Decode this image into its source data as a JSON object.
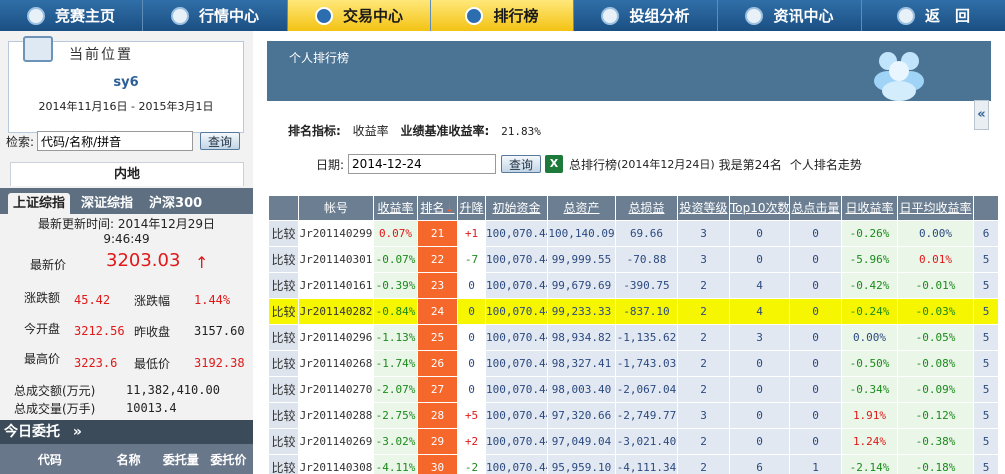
{
  "nav": {
    "items": [
      {
        "label": "竞赛主页",
        "icon": "home-icon",
        "active": false
      },
      {
        "label": "行情中心",
        "icon": "chart-icon",
        "active": false
      },
      {
        "label": "交易中心",
        "icon": "trade-icon",
        "active": true
      },
      {
        "label": "排行榜",
        "icon": "ranking-icon",
        "active": true
      },
      {
        "label": "投组分析",
        "icon": "analysis-icon",
        "active": false
      },
      {
        "label": "资讯中心",
        "icon": "news-icon",
        "active": false
      },
      {
        "label": "返　回",
        "icon": "back-icon",
        "active": false
      }
    ]
  },
  "position": {
    "title": "当前位置",
    "user": "sy6",
    "range": "2014年11月16日 - 2015年3月1日"
  },
  "search": {
    "label": "检索:",
    "value": "代码/名称/拼音",
    "button": "查询"
  },
  "market": {
    "header": "内地",
    "tabs": [
      "上证综指",
      "深证综指",
      "沪深300"
    ],
    "update_label": "最新更新时间:",
    "update_time": "2014年12月29日",
    "update_clock": "9:46:49",
    "latest_label": "最新价",
    "latest_value": "3203.03",
    "latest_arrow": "↑",
    "change_label": "涨跌额",
    "change_value": "45.42",
    "change_pct_label": "涨跌幅",
    "change_pct_value": "1.44%",
    "open_label": "今开盘",
    "open_value": "3212.56",
    "prev_label": "昨收盘",
    "prev_value": "3157.60",
    "high_label": "最高价",
    "high_value": "3223.6",
    "low_label": "最低价",
    "low_value": "3192.38",
    "turnover_label": "总成交额(万元)",
    "turnover_value": "11,382,410.00",
    "volume_label": "总成交量(万手)",
    "volume_value": "10013.4"
  },
  "entrust": {
    "title": "今日委托",
    "arrow": "»",
    "headers": [
      "代码",
      "名称",
      "委托量",
      "委托价"
    ]
  },
  "ranking": {
    "banner_title": "个人排行榜",
    "indicator_label": "排名指标:",
    "indicator_value": "收益率",
    "benchmark_label": "业绩基准收益率:",
    "benchmark_value": "21.83%",
    "date_label": "日期:",
    "date_value": "2014-12-24",
    "query_button": "查询",
    "excel_icon_text": "X",
    "summary": "总排行榜",
    "summary_date": "(2014年12月24日)",
    "my_rank_text": "我是第24名",
    "trend_link": "个人排名走势",
    "collapse_symbol": "«"
  },
  "table": {
    "headers": [
      "",
      "帐号",
      "收益率",
      "排名",
      "升降",
      "初始资金",
      "总资产",
      "总损益",
      "投资等级",
      "Top10次数",
      "总点击量",
      "日收益率",
      "日平均收益率",
      ""
    ],
    "sort_arrow": "↓",
    "rows": [
      {
        "cmp": "比较",
        "acct": "Jr201140299",
        "rate": "0.07%",
        "rank": "21",
        "chg": "+1",
        "init": "100,070.44",
        "assets": "100,140.09",
        "pl": "69.66",
        "level": "3",
        "top10": "0",
        "clicks": "0",
        "day": "-0.26%",
        "avg": "0.00%",
        "extra": "6",
        "highlight": false
      },
      {
        "cmp": "比较",
        "acct": "Jr201140301",
        "rate": "-0.07%",
        "rank": "22",
        "chg": "-7",
        "init": "100,070.44",
        "assets": "99,999.55",
        "pl": "-70.88",
        "level": "3",
        "top10": "0",
        "clicks": "0",
        "day": "-5.96%",
        "avg": "0.01%",
        "extra": "5",
        "highlight": false
      },
      {
        "cmp": "比较",
        "acct": "Jr201140161",
        "rate": "-0.39%",
        "rank": "23",
        "chg": "0",
        "init": "100,070.44",
        "assets": "99,679.69",
        "pl": "-390.75",
        "level": "2",
        "top10": "4",
        "clicks": "0",
        "day": "-0.42%",
        "avg": "-0.01%",
        "extra": "5",
        "highlight": false
      },
      {
        "cmp": "比较",
        "acct": "Jr201140282",
        "rate": "-0.84%",
        "rank": "24",
        "chg": "0",
        "init": "100,070.44",
        "assets": "99,233.33",
        "pl": "-837.10",
        "level": "2",
        "top10": "4",
        "clicks": "0",
        "day": "-0.24%",
        "avg": "-0.03%",
        "extra": "5",
        "highlight": true
      },
      {
        "cmp": "比较",
        "acct": "Jr201140296",
        "rate": "-1.13%",
        "rank": "25",
        "chg": "0",
        "init": "100,070.44",
        "assets": "98,934.82",
        "pl": "-1,135.62",
        "level": "2",
        "top10": "3",
        "clicks": "0",
        "day": "0.00%",
        "avg": "-0.05%",
        "extra": "5",
        "highlight": false
      },
      {
        "cmp": "比较",
        "acct": "Jr201140268",
        "rate": "-1.74%",
        "rank": "26",
        "chg": "0",
        "init": "100,070.44",
        "assets": "98,327.41",
        "pl": "-1,743.03",
        "level": "2",
        "top10": "0",
        "clicks": "0",
        "day": "-0.50%",
        "avg": "-0.08%",
        "extra": "5",
        "highlight": false
      },
      {
        "cmp": "比较",
        "acct": "Jr201140270",
        "rate": "-2.07%",
        "rank": "27",
        "chg": "0",
        "init": "100,070.44",
        "assets": "98,003.40",
        "pl": "-2,067.04",
        "level": "2",
        "top10": "0",
        "clicks": "0",
        "day": "-0.34%",
        "avg": "-0.09%",
        "extra": "5",
        "highlight": false
      },
      {
        "cmp": "比较",
        "acct": "Jr201140288",
        "rate": "-2.75%",
        "rank": "28",
        "chg": "+5",
        "init": "100,070.44",
        "assets": "97,320.66",
        "pl": "-2,749.77",
        "level": "3",
        "top10": "0",
        "clicks": "0",
        "day": "1.91%",
        "avg": "-0.12%",
        "extra": "5",
        "highlight": false
      },
      {
        "cmp": "比较",
        "acct": "Jr201140269",
        "rate": "-3.02%",
        "rank": "29",
        "chg": "+2",
        "init": "100,070.44",
        "assets": "97,049.04",
        "pl": "-3,021.40",
        "level": "2",
        "top10": "0",
        "clicks": "0",
        "day": "1.24%",
        "avg": "-0.38%",
        "extra": "5",
        "highlight": false
      },
      {
        "cmp": "比较",
        "acct": "Jr201140308",
        "rate": "-4.11%",
        "rank": "30",
        "chg": "-2",
        "init": "100,070.44",
        "assets": "95,959.10",
        "pl": "-4,111.34",
        "level": "2",
        "top10": "6",
        "clicks": "1",
        "day": "-2.14%",
        "avg": "-0.18%",
        "extra": "5",
        "highlight": false
      }
    ]
  },
  "colors": {
    "nav_bg": "#1b4f83",
    "nav_active": "#f3c213",
    "rank_cell": "#f6672c",
    "highlight_row": "#f6f600",
    "positive": "#e01818",
    "negative": "#1b8a1b"
  }
}
